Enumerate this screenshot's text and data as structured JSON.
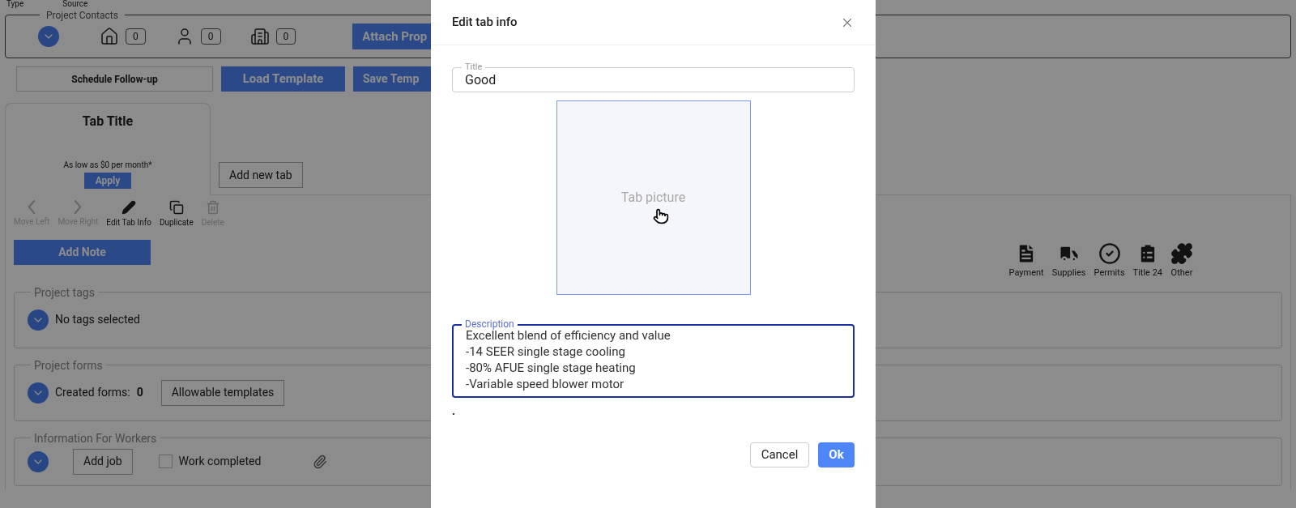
{
  "top_labels": [
    "Type",
    "Source"
  ],
  "project_contacts": {
    "legend": "Project Contacts",
    "counters": [
      {
        "kind": "home",
        "value": "0"
      },
      {
        "kind": "person",
        "value": "0"
      },
      {
        "kind": "building",
        "value": "0"
      }
    ],
    "attach_button": "Attach Prop"
  },
  "actions": [
    {
      "label": "Schedule Follow-up",
      "kind": "outline"
    },
    {
      "label": "Load Template",
      "kind": "primary"
    },
    {
      "label": "Save Temp",
      "kind": "primary"
    }
  ],
  "tab_card": {
    "title": "Tab Title",
    "price_note": "As low as $0 per month*",
    "apply": "Apply"
  },
  "add_tab_button": "Add new tab",
  "toolbar": [
    {
      "label": "Move Left",
      "kind": "left",
      "disabled": true
    },
    {
      "label": "Move Right",
      "kind": "right",
      "disabled": true
    },
    {
      "label": "Edit Tab Info",
      "kind": "edit",
      "disabled": false
    },
    {
      "label": "Duplicate",
      "kind": "duplicate",
      "disabled": false
    },
    {
      "label": "Delete",
      "kind": "delete",
      "disabled": true
    }
  ],
  "add_note_button": "Add Note",
  "categories": [
    {
      "label": "Payment",
      "kind": "payment"
    },
    {
      "label": "Supplies",
      "kind": "supplies"
    },
    {
      "label": "Permits",
      "kind": "permits"
    },
    {
      "label": "Title 24",
      "kind": "title24"
    },
    {
      "label": "Other",
      "kind": "other"
    }
  ],
  "project_tags": {
    "legend": "Project tags",
    "text": "No tags selected"
  },
  "project_forms": {
    "legend": "Project forms",
    "label": "Created forms:",
    "count": "0",
    "button": "Allowable templates"
  },
  "workers": {
    "legend": "Information For Workers",
    "add_job": "Add job",
    "checkbox": {
      "label": "Work completed",
      "checked": false
    }
  },
  "modal": {
    "title": "Edit tab info",
    "title_field": {
      "label": "Title",
      "value": "Good"
    },
    "picture": {
      "placeholder": "Tab picture"
    },
    "description": {
      "label": "Description",
      "value": "Excellent blend of efficiency and value\n-14 SEER single stage cooling\n-80% AFUE single stage heating\n-Variable speed blower motor"
    },
    "note": ".",
    "buttons": [
      {
        "label": "Cancel",
        "kind": "secondary"
      },
      {
        "label": "Ok",
        "kind": "primary"
      }
    ]
  }
}
